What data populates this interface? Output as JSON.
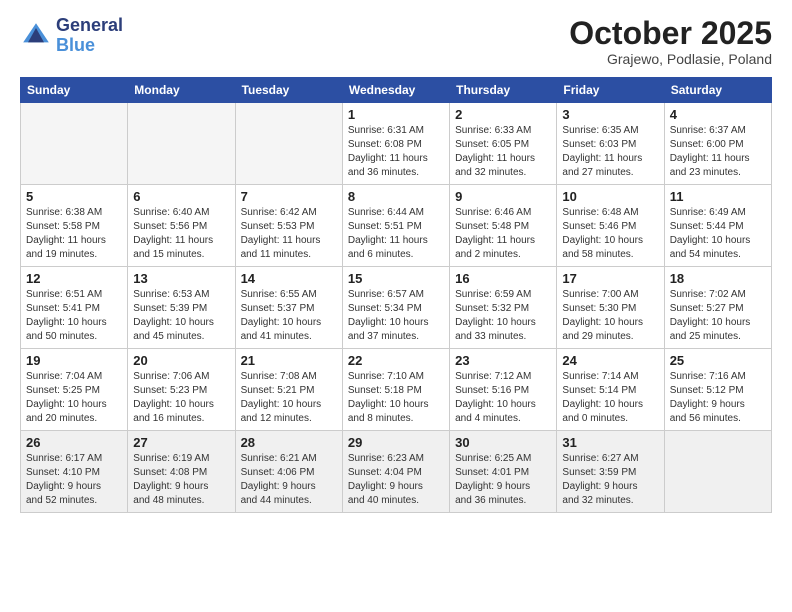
{
  "header": {
    "logo_line1": "General",
    "logo_line2": "Blue",
    "month_title": "October 2025",
    "location": "Grajewo, Podlasie, Poland"
  },
  "weekdays": [
    "Sunday",
    "Monday",
    "Tuesday",
    "Wednesday",
    "Thursday",
    "Friday",
    "Saturday"
  ],
  "weeks": [
    [
      {
        "num": "",
        "detail": ""
      },
      {
        "num": "",
        "detail": ""
      },
      {
        "num": "",
        "detail": ""
      },
      {
        "num": "1",
        "detail": "Sunrise: 6:31 AM\nSunset: 6:08 PM\nDaylight: 11 hours\nand 36 minutes."
      },
      {
        "num": "2",
        "detail": "Sunrise: 6:33 AM\nSunset: 6:05 PM\nDaylight: 11 hours\nand 32 minutes."
      },
      {
        "num": "3",
        "detail": "Sunrise: 6:35 AM\nSunset: 6:03 PM\nDaylight: 11 hours\nand 27 minutes."
      },
      {
        "num": "4",
        "detail": "Sunrise: 6:37 AM\nSunset: 6:00 PM\nDaylight: 11 hours\nand 23 minutes."
      }
    ],
    [
      {
        "num": "5",
        "detail": "Sunrise: 6:38 AM\nSunset: 5:58 PM\nDaylight: 11 hours\nand 19 minutes."
      },
      {
        "num": "6",
        "detail": "Sunrise: 6:40 AM\nSunset: 5:56 PM\nDaylight: 11 hours\nand 15 minutes."
      },
      {
        "num": "7",
        "detail": "Sunrise: 6:42 AM\nSunset: 5:53 PM\nDaylight: 11 hours\nand 11 minutes."
      },
      {
        "num": "8",
        "detail": "Sunrise: 6:44 AM\nSunset: 5:51 PM\nDaylight: 11 hours\nand 6 minutes."
      },
      {
        "num": "9",
        "detail": "Sunrise: 6:46 AM\nSunset: 5:48 PM\nDaylight: 11 hours\nand 2 minutes."
      },
      {
        "num": "10",
        "detail": "Sunrise: 6:48 AM\nSunset: 5:46 PM\nDaylight: 10 hours\nand 58 minutes."
      },
      {
        "num": "11",
        "detail": "Sunrise: 6:49 AM\nSunset: 5:44 PM\nDaylight: 10 hours\nand 54 minutes."
      }
    ],
    [
      {
        "num": "12",
        "detail": "Sunrise: 6:51 AM\nSunset: 5:41 PM\nDaylight: 10 hours\nand 50 minutes."
      },
      {
        "num": "13",
        "detail": "Sunrise: 6:53 AM\nSunset: 5:39 PM\nDaylight: 10 hours\nand 45 minutes."
      },
      {
        "num": "14",
        "detail": "Sunrise: 6:55 AM\nSunset: 5:37 PM\nDaylight: 10 hours\nand 41 minutes."
      },
      {
        "num": "15",
        "detail": "Sunrise: 6:57 AM\nSunset: 5:34 PM\nDaylight: 10 hours\nand 37 minutes."
      },
      {
        "num": "16",
        "detail": "Sunrise: 6:59 AM\nSunset: 5:32 PM\nDaylight: 10 hours\nand 33 minutes."
      },
      {
        "num": "17",
        "detail": "Sunrise: 7:00 AM\nSunset: 5:30 PM\nDaylight: 10 hours\nand 29 minutes."
      },
      {
        "num": "18",
        "detail": "Sunrise: 7:02 AM\nSunset: 5:27 PM\nDaylight: 10 hours\nand 25 minutes."
      }
    ],
    [
      {
        "num": "19",
        "detail": "Sunrise: 7:04 AM\nSunset: 5:25 PM\nDaylight: 10 hours\nand 20 minutes."
      },
      {
        "num": "20",
        "detail": "Sunrise: 7:06 AM\nSunset: 5:23 PM\nDaylight: 10 hours\nand 16 minutes."
      },
      {
        "num": "21",
        "detail": "Sunrise: 7:08 AM\nSunset: 5:21 PM\nDaylight: 10 hours\nand 12 minutes."
      },
      {
        "num": "22",
        "detail": "Sunrise: 7:10 AM\nSunset: 5:18 PM\nDaylight: 10 hours\nand 8 minutes."
      },
      {
        "num": "23",
        "detail": "Sunrise: 7:12 AM\nSunset: 5:16 PM\nDaylight: 10 hours\nand 4 minutes."
      },
      {
        "num": "24",
        "detail": "Sunrise: 7:14 AM\nSunset: 5:14 PM\nDaylight: 10 hours\nand 0 minutes."
      },
      {
        "num": "25",
        "detail": "Sunrise: 7:16 AM\nSunset: 5:12 PM\nDaylight: 9 hours\nand 56 minutes."
      }
    ],
    [
      {
        "num": "26",
        "detail": "Sunrise: 6:17 AM\nSunset: 4:10 PM\nDaylight: 9 hours\nand 52 minutes."
      },
      {
        "num": "27",
        "detail": "Sunrise: 6:19 AM\nSunset: 4:08 PM\nDaylight: 9 hours\nand 48 minutes."
      },
      {
        "num": "28",
        "detail": "Sunrise: 6:21 AM\nSunset: 4:06 PM\nDaylight: 9 hours\nand 44 minutes."
      },
      {
        "num": "29",
        "detail": "Sunrise: 6:23 AM\nSunset: 4:04 PM\nDaylight: 9 hours\nand 40 minutes."
      },
      {
        "num": "30",
        "detail": "Sunrise: 6:25 AM\nSunset: 4:01 PM\nDaylight: 9 hours\nand 36 minutes."
      },
      {
        "num": "31",
        "detail": "Sunrise: 6:27 AM\nSunset: 3:59 PM\nDaylight: 9 hours\nand 32 minutes."
      },
      {
        "num": "",
        "detail": ""
      }
    ]
  ]
}
